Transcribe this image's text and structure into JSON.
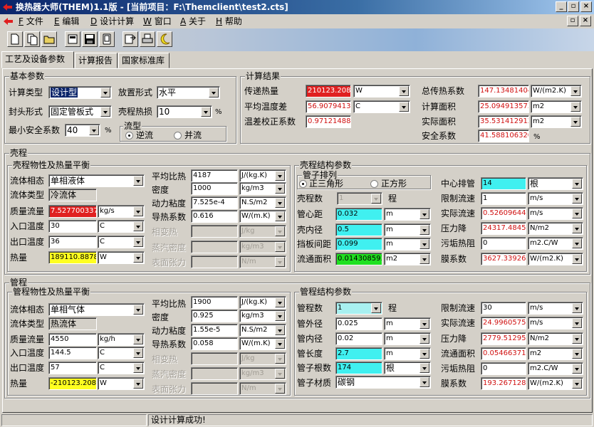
{
  "window": {
    "title": "换热器大师(THEM)1.1版 - [当前项目：F:\\Themclient\\test2.cts]",
    "min": "_",
    "max": "▫",
    "close": "×"
  },
  "menu": [
    {
      "key": "F",
      "label": "文件"
    },
    {
      "key": "E",
      "label": "编辑"
    },
    {
      "key": "D",
      "label": "设计计算"
    },
    {
      "key": "W",
      "label": "窗口"
    },
    {
      "key": "A",
      "label": "关于"
    },
    {
      "key": "H",
      "label": "帮助"
    }
  ],
  "tabs": [
    "工艺及设备参数",
    "计算报告",
    "国家标准库"
  ],
  "basic": {
    "title": "基本参数",
    "calc_type_label": "计算类型",
    "calc_type": "设计型",
    "place_label": "放置形式",
    "place": "水平",
    "head_label": "封头形式",
    "head": "固定管板式",
    "loss_label": "壳程热损",
    "loss": "10",
    "pct": "%",
    "safety_label": "最小安全系数",
    "safety": "40",
    "pct2": "%",
    "flow_title": "流型",
    "flow_counter": "逆流",
    "flow_parallel": "并流"
  },
  "result": {
    "title": "计算结果",
    "q_label": "传递热量",
    "q": "210123.2087",
    "q_unit": "W",
    "dt_label": "平均温度差",
    "dt": "56.9079413305",
    "dt_unit": "C",
    "f_label": "温差校正系数",
    "f": "0.9712148819",
    "k_label": "总传热系数",
    "k": "147.1348140444",
    "k_unit": "W/(m2.K)",
    "a_label": "计算面积",
    "a": "25.0949135739",
    "a_unit": "m2",
    "aa_label": "实际面积",
    "aa": "35.5314129121",
    "aa_unit": "m2",
    "sf_label": "安全系数",
    "sf": "41.5881063205",
    "sf_unit": "%"
  },
  "shell": {
    "title": "壳程",
    "props_title": "壳程物性及热量平衡",
    "phase_label": "流体相态",
    "phase": "单相液体",
    "ftype_label": "流体类型",
    "ftype": "冷流体",
    "mass_label": "质量流量",
    "mass": "7.52770033731",
    "mass_unit": "kg/s",
    "tin_label": "入口温度",
    "tin": "30",
    "tin_unit": "C",
    "tout_label": "出口温度",
    "tout": "36",
    "tout_unit": "C",
    "heat_label": "热量",
    "heat": "189110.887875",
    "heat_unit": "W",
    "cp_label": "平均比热",
    "cp": "4187",
    "cp_unit": "J/(kg.K)",
    "rho_label": "密度",
    "rho": "1000",
    "rho_unit": "kg/m3",
    "mu_label": "动力粘度",
    "mu": "7.525e-4",
    "mu_unit": "N.S/m2",
    "lam_label": "导热系数",
    "lam": "0.616",
    "lam_unit": "W/(m.K)",
    "ph_label": "相变热",
    "ph_unit": "J/kg",
    "vd_label": "蒸汽密度",
    "vd_unit": "kg/m3",
    "st_label": "表面张力",
    "st_unit": "N/m",
    "struct_title": "壳程结构参数",
    "arr_title": "管子排列",
    "tri": "正三角形",
    "sq": "正方形",
    "passes_label": "壳程数",
    "passes": "1",
    "passes_unit": "程",
    "pitch_label": "管心距",
    "pitch": "0.032",
    "pitch_unit": "m",
    "id_label": "壳内径",
    "id": "0.5",
    "id_unit": "m",
    "baffle_label": "挡板间距",
    "baffle": "0.099",
    "baffle_unit": "m",
    "area_label": "流通面积",
    "area": "0.01430859373",
    "area_unit": "m2",
    "center_label": "中心排管",
    "center": "14",
    "center_unit": "根",
    "vlim_label": "限制流速",
    "vlim": "1",
    "vlim_unit": "m/s",
    "v_label": "实际流速",
    "v": "0.52609644727",
    "v_unit": "m/s",
    "dp_label": "压力降",
    "dp": "24317.4845080",
    "dp_unit": "N/m2",
    "foul_label": "污垢热阻",
    "foul": "0",
    "foul_unit": "m2.C/W",
    "h_label": "膜系数",
    "h": "3627.33926720",
    "h_unit": "W/(m2.K)"
  },
  "tube": {
    "title": "管程",
    "props_title": "管程物性及热量平衡",
    "phase_label": "流体相态",
    "phase": "单相气体",
    "ftype_label": "流体类型",
    "ftype": "热流体",
    "mass_label": "质量流量",
    "mass": "4550",
    "mass_unit": "kg/h",
    "tin_label": "入口温度",
    "tin": "144.5",
    "tin_unit": "C",
    "tout_label": "出口温度",
    "tout": "57",
    "tout_unit": "C",
    "heat_label": "热量",
    "heat": "-210123.20875",
    "heat_unit": "W",
    "cp_label": "平均比热",
    "cp": "1900",
    "cp_unit": "J/(kg.K)",
    "rho_label": "密度",
    "rho": "0.925",
    "rho_unit": "kg/m3",
    "mu_label": "动力粘度",
    "mu": "1.55e-5",
    "mu_unit": "N.S/m2",
    "lam_label": "导热系数",
    "lam": "0.058",
    "lam_unit": "W/(m.K)",
    "ph_label": "相变热",
    "ph_unit": "J/kg",
    "vd_label": "蒸汽密度",
    "vd_unit": "kg/m3",
    "st_label": "表面张力",
    "st_unit": "N/m",
    "struct_title": "管程结构参数",
    "passes_label": "管程数",
    "passes": "1",
    "passes_unit": "程",
    "od_label": "管外径",
    "od": "0.025",
    "od_unit": "m",
    "idd_label": "管内径",
    "idd": "0.02",
    "idd_unit": "m",
    "len_label": "管长度",
    "len": "2.7",
    "len_unit": "m",
    "n_label": "管子根数",
    "n": "174",
    "n_unit": "根",
    "mat_label": "管子材质",
    "mat": "碳钢",
    "vlim_label": "限制流速",
    "vlim": "30",
    "vlim_unit": "m/s",
    "v_label": "实际流速",
    "v": "24.9960575856",
    "v_unit": "m/s",
    "dp_label": "压力降",
    "dp": "2779.51295412",
    "dp_unit": "N/m2",
    "area_label": "流通面积",
    "area": "0.05466371217",
    "area_unit": "m2",
    "foul_label": "污垢热阻",
    "foul": "0",
    "foul_unit": "m2.C/W",
    "h_label": "膜系数",
    "h": "193.267128252",
    "h_unit": "W/(m2.K)"
  },
  "status": {
    "message": "设计计算成功!"
  },
  "icons": [
    "new-doc-icon",
    "copy-doc-icon",
    "open-folder-icon",
    "print-preview-icon",
    "save-icon",
    "save-all-icon",
    "export-icon",
    "print-icon",
    "calculate-icon"
  ],
  "colors": {
    "title_start": "#0a246a",
    "red_field": "#e02020",
    "cyan_field": "#40f0f0",
    "green_field": "#20e020",
    "yellow_field": "#ffff20",
    "red_text": "#d01010"
  }
}
